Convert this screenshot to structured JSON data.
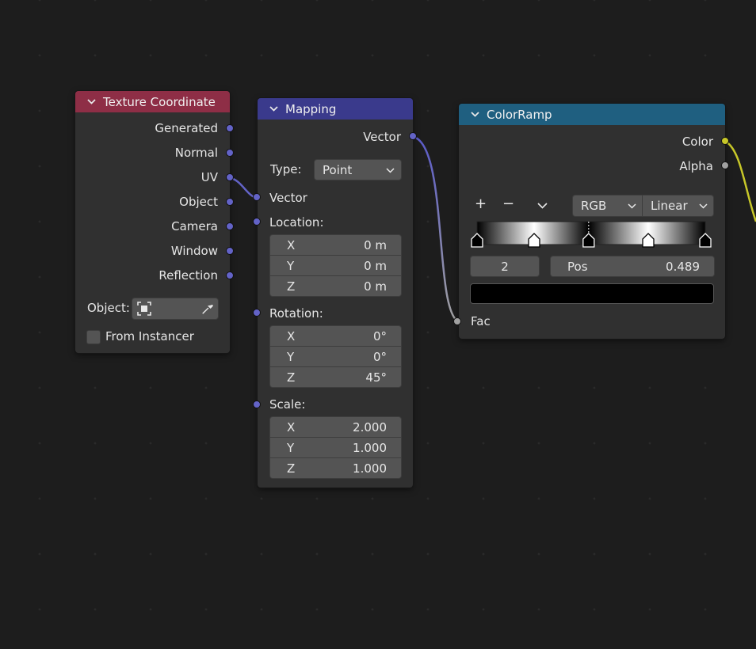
{
  "texture_coordinate": {
    "title": "Texture Coordinate",
    "outputs": [
      "Generated",
      "Normal",
      "UV",
      "Object",
      "Camera",
      "Window",
      "Reflection"
    ],
    "object_label": "Object:",
    "from_instancer_label": "From Instancer",
    "from_instancer_checked": false,
    "header_color": "#8e2e46",
    "icons": [
      "chevron-down-icon",
      "object-icon",
      "eyedropper-icon"
    ]
  },
  "mapping": {
    "title": "Mapping",
    "output_vector": "Vector",
    "type_label": "Type:",
    "type_value": "Point",
    "input_vector": "Vector",
    "location_label": "Location:",
    "location": [
      {
        "axis": "X",
        "value": "0 m"
      },
      {
        "axis": "Y",
        "value": "0 m"
      },
      {
        "axis": "Z",
        "value": "0 m"
      }
    ],
    "rotation_label": "Rotation:",
    "rotation": [
      {
        "axis": "X",
        "value": "0°"
      },
      {
        "axis": "Y",
        "value": "0°"
      },
      {
        "axis": "Z",
        "value": "45°"
      }
    ],
    "scale_label": "Scale:",
    "scale": [
      {
        "axis": "X",
        "value": "2.000"
      },
      {
        "axis": "Y",
        "value": "1.000"
      },
      {
        "axis": "Z",
        "value": "1.000"
      }
    ],
    "header_color": "#3a3a8c"
  },
  "colorramp": {
    "title": "ColorRamp",
    "out_color": "Color",
    "out_alpha": "Alpha",
    "add_label": "+",
    "remove_label": "−",
    "color_mode": "RGB",
    "interpolation": "Linear",
    "active_index": "2",
    "pos_label": "Pos",
    "pos_value": "0.489",
    "fac_label": "Fac",
    "stop_positions": [
      0.0,
      0.25,
      0.489,
      0.75,
      1.0
    ],
    "stop_colors": [
      "#000000",
      "#ffffff",
      "#000000",
      "#ffffff",
      "#000000"
    ],
    "active_stop_color": "#000000",
    "header_color": "#1f5f80"
  },
  "colors": {
    "vector_socket": "#6363c7",
    "grey_socket": "#a1a1a1",
    "color_socket": "#c7c729",
    "background": "#1d1d1d"
  }
}
